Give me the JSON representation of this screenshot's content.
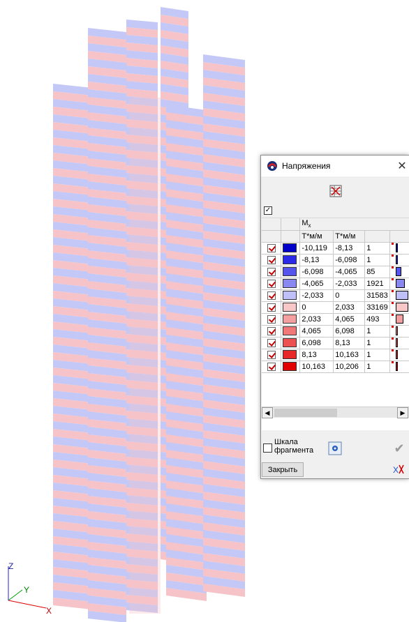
{
  "viewport": {
    "axes": {
      "x": "X",
      "y": "Y",
      "z": "Z"
    }
  },
  "dialog": {
    "title": "Напряжения",
    "close_glyph": "✕",
    "header_checkbox_checked": true,
    "component_label": "M",
    "component_subscript": "x",
    "units": [
      "Т*м/м",
      "Т*м/м"
    ],
    "rows": [
      {
        "color": "#0000c8",
        "from": "-10,119",
        "to": "-8,13",
        "count": "1"
      },
      {
        "color": "#2a2ae8",
        "from": "-8,13",
        "to": "-6,098",
        "count": "1"
      },
      {
        "color": "#5555ee",
        "from": "-6,098",
        "to": "-4,065",
        "count": "85"
      },
      {
        "color": "#8888f0",
        "from": "-4,065",
        "to": "-2,033",
        "count": "1921"
      },
      {
        "color": "#c0c0f8",
        "from": "-2,033",
        "to": "0",
        "count": "31583"
      },
      {
        "color": "#f8c8c8",
        "from": "0",
        "to": "2,033",
        "count": "33169"
      },
      {
        "color": "#f4a0a0",
        "from": "2,033",
        "to": "4,065",
        "count": "493"
      },
      {
        "color": "#f07878",
        "from": "4,065",
        "to": "6,098",
        "count": "1"
      },
      {
        "color": "#ec5050",
        "from": "6,098",
        "to": "8,13",
        "count": "1"
      },
      {
        "color": "#e82828",
        "from": "8,13",
        "to": "10,163",
        "count": "1"
      },
      {
        "color": "#e00000",
        "from": "10,163",
        "to": "10,206",
        "count": "1"
      }
    ],
    "fragment_scale_label_1": "Шкала",
    "fragment_scale_label_2": "фрагмента",
    "close_button": "Закрыть"
  },
  "colors": {
    "blue_band": "#c4c8f6",
    "red_band": "#f6c4c8"
  }
}
